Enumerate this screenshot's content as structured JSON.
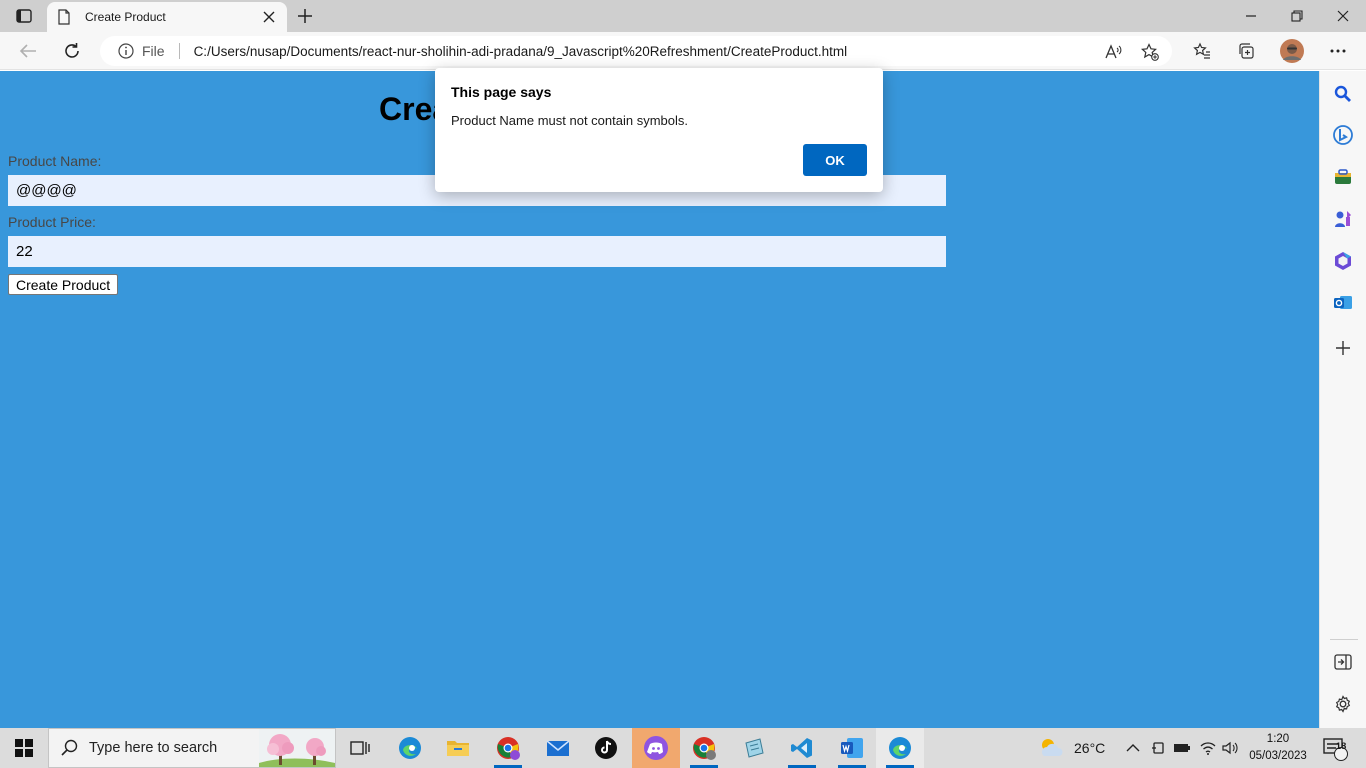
{
  "browser": {
    "tab_title": "Create Product",
    "address_scheme_label": "File",
    "url": "C:/Users/nusap/Documents/react-nur-sholihin-adi-pradana/9_Javascript%20Refreshment/CreateProduct.html"
  },
  "page": {
    "heading": "Create Product",
    "name_label": "Product Name:",
    "name_value": "@@@@",
    "price_label": "Product Price:",
    "price_value": "22",
    "submit_label": "Create Product",
    "background_color": "#3897db"
  },
  "dialog": {
    "title": "This page says",
    "message": "Product Name must not contain symbols.",
    "ok_label": "OK",
    "ok_color": "#0067c0"
  },
  "taskbar": {
    "search_placeholder": "Type here to search",
    "weather_temp": "26°C",
    "time": "1:20",
    "date": "05/03/2023",
    "notification_count": "18"
  }
}
